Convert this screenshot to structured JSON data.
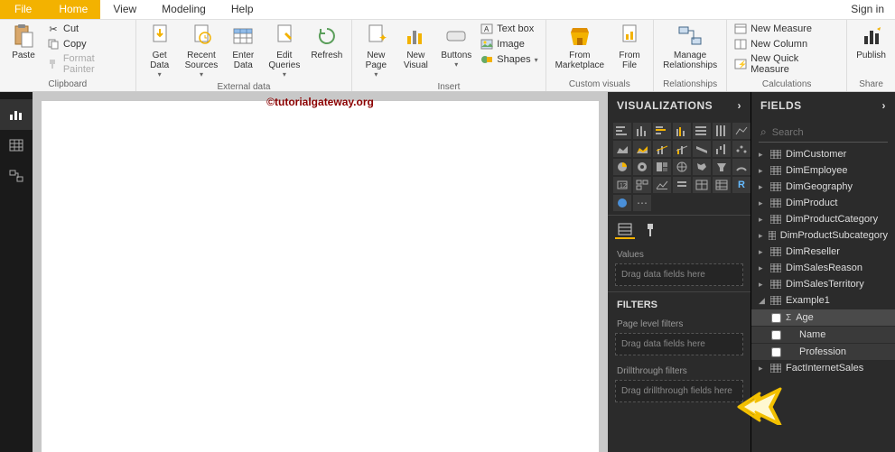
{
  "menubar": {
    "file": "File",
    "home": "Home",
    "view": "View",
    "modeling": "Modeling",
    "help": "Help",
    "signin": "Sign in"
  },
  "ribbon": {
    "clipboard": {
      "paste": "Paste",
      "cut": "Cut",
      "copy": "Copy",
      "format_painter": "Format Painter",
      "label": "Clipboard"
    },
    "external": {
      "get_data": "Get\nData",
      "recent_sources": "Recent\nSources",
      "enter_data": "Enter\nData",
      "edit_queries": "Edit\nQueries",
      "refresh": "Refresh",
      "label": "External data"
    },
    "insert": {
      "new_page": "New\nPage",
      "new_visual": "New\nVisual",
      "buttons": "Buttons",
      "text_box": "Text box",
      "image": "Image",
      "shapes": "Shapes",
      "label": "Insert"
    },
    "custom": {
      "marketplace": "From\nMarketplace",
      "file": "From\nFile",
      "label": "Custom visuals"
    },
    "relationships": {
      "manage": "Manage\nRelationships",
      "label": "Relationships"
    },
    "calculations": {
      "new_measure": "New Measure",
      "new_column": "New Column",
      "new_quick": "New Quick Measure",
      "label": "Calculations"
    },
    "share": {
      "publish": "Publish",
      "label": "Share"
    }
  },
  "watermark": "©tutorialgateway.org",
  "viz_panel": {
    "title": "VISUALIZATIONS",
    "values_label": "Values",
    "values_drop": "Drag data fields here",
    "filters_title": "FILTERS",
    "page_filters_label": "Page level filters",
    "page_filters_drop": "Drag data fields here",
    "drill_label": "Drillthrough filters",
    "drill_drop": "Drag drillthrough fields here"
  },
  "fields_panel": {
    "title": "FIELDS",
    "search_placeholder": "Search",
    "tables": [
      {
        "name": "DimCustomer",
        "expanded": false
      },
      {
        "name": "DimEmployee",
        "expanded": false
      },
      {
        "name": "DimGeography",
        "expanded": false
      },
      {
        "name": "DimProduct",
        "expanded": false
      },
      {
        "name": "DimProductCategory",
        "expanded": false
      },
      {
        "name": "DimProductSubcategory",
        "expanded": false
      },
      {
        "name": "DimReseller",
        "expanded": false
      },
      {
        "name": "DimSalesReason",
        "expanded": false
      },
      {
        "name": "DimSalesTerritory",
        "expanded": false
      },
      {
        "name": "Example1",
        "expanded": true,
        "children": [
          {
            "name": "Age",
            "sigma": true
          },
          {
            "name": "Name",
            "sigma": false
          },
          {
            "name": "Profession",
            "sigma": false
          }
        ]
      },
      {
        "name": "FactInternetSales",
        "expanded": false
      }
    ]
  }
}
